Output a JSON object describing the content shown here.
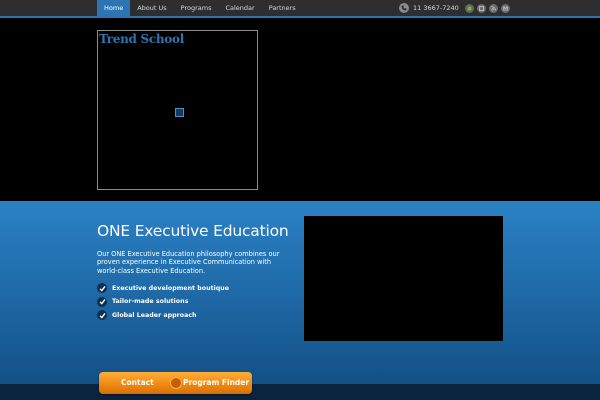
{
  "nav": {
    "items": [
      {
        "label": "Home",
        "active": true
      },
      {
        "label": "About Us",
        "active": false
      },
      {
        "label": "Programs",
        "active": false
      },
      {
        "label": "Calendar",
        "active": false
      },
      {
        "label": "Partners",
        "active": false
      }
    ]
  },
  "contact": {
    "phone": "11 3667-7240",
    "phone_icon": "phone-icon",
    "social_icons": [
      "social-icon-1",
      "social-icon-2",
      "rss-icon",
      "email-icon"
    ]
  },
  "logo": {
    "title": "Trend School"
  },
  "hero": {
    "headline": "ONE Executive Education",
    "intro": "Our ONE Executive Education philosophy combines our proven experience in Executive Communication with world-class Executive Education.",
    "bullets": [
      "Executive development boutique",
      "Tailor-made solutions",
      "Global Leader approach"
    ]
  },
  "cta": {
    "contact_label": "Contact",
    "finder_label": "Program Finder"
  },
  "colors": {
    "accent": "#2d74b3",
    "cta": "#f08a14",
    "topbar": "#2e2e2e"
  }
}
